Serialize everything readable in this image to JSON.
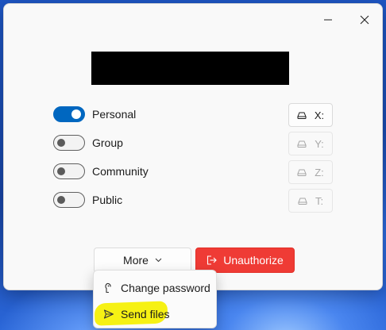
{
  "toggles": [
    {
      "label": "Personal",
      "on": true
    },
    {
      "label": "Group",
      "on": false
    },
    {
      "label": "Community",
      "on": false
    },
    {
      "label": "Public",
      "on": false
    }
  ],
  "drives": [
    {
      "letter": "X:",
      "enabled": true
    },
    {
      "letter": "Y:",
      "enabled": false
    },
    {
      "letter": "Z:",
      "enabled": false
    },
    {
      "letter": "T:",
      "enabled": false
    }
  ],
  "actions": {
    "more_label": "More",
    "unauthorize_label": "Unauthorize"
  },
  "menu": {
    "items": [
      {
        "label": "Change password",
        "icon": "password-icon"
      },
      {
        "label": "Send files",
        "icon": "send-icon",
        "highlighted": true
      }
    ]
  },
  "colors": {
    "accent": "#0067c0",
    "danger": "#ef3b35",
    "highlight": "#f5f000"
  }
}
